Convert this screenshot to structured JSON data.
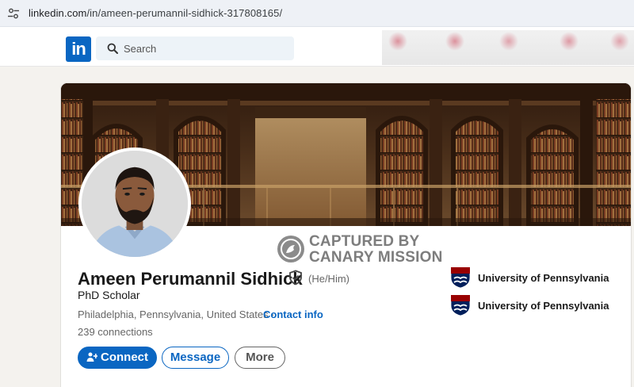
{
  "browser": {
    "url_host": "linkedin.com",
    "url_path": "/in/ameen-perumannil-sidhick-317808165/",
    "site_info_icon": "tune-icon"
  },
  "header": {
    "logo_text": "in",
    "search_placeholder": "Search",
    "search_icon": "search-icon",
    "brand_color": "#0a66c2"
  },
  "watermark": {
    "line1": "CAPTURED BY",
    "line2": "CANARY MISSION"
  },
  "profile": {
    "name": "Ameen Perumannil Sidhick",
    "pronouns": "(He/Him)",
    "headline": "PhD Scholar",
    "location": "Philadelphia, Pennsylvania, United States",
    "separator": " · ",
    "contact_label": "Contact info",
    "connections": "239 connections"
  },
  "actions": {
    "connect_label": "Connect",
    "message_label": "Message",
    "more_label": "More"
  },
  "education": [
    {
      "name": "University of Pennsylvania"
    },
    {
      "name": "University of Pennsylvania"
    }
  ]
}
